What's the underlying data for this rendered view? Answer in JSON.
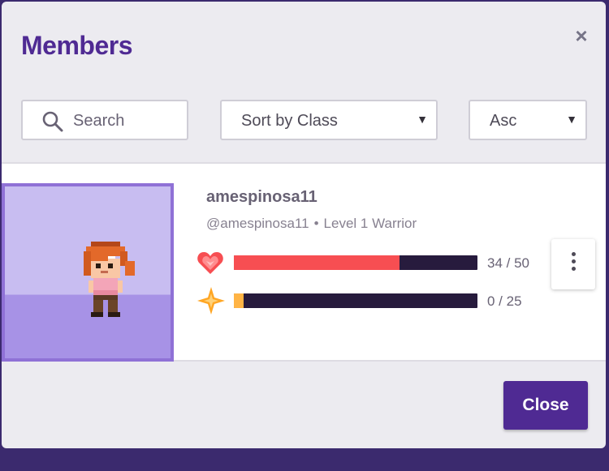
{
  "modal": {
    "title": "Members",
    "close_icon": "×",
    "close_button_label": "Close"
  },
  "filters": {
    "search_placeholder": "Search",
    "search_value": "",
    "sort_by": "Sort by Class",
    "order": "Asc",
    "caret": "▼"
  },
  "members": [
    {
      "display_name": "amespinosa11",
      "handle": "@amespinosa11",
      "separator": "•",
      "level_class": "Level 1 Warrior",
      "health": {
        "current": 34,
        "max": 50,
        "label": "34 / 50",
        "color": "#f74e52"
      },
      "mana": {
        "current": 0,
        "max": 25,
        "label": "0 / 25",
        "color": "#ffb445"
      }
    }
  ],
  "colors": {
    "accent": "#4f2a93",
    "avatar_bg": "#c8bdf1",
    "avatar_border": "#8f71d6"
  }
}
